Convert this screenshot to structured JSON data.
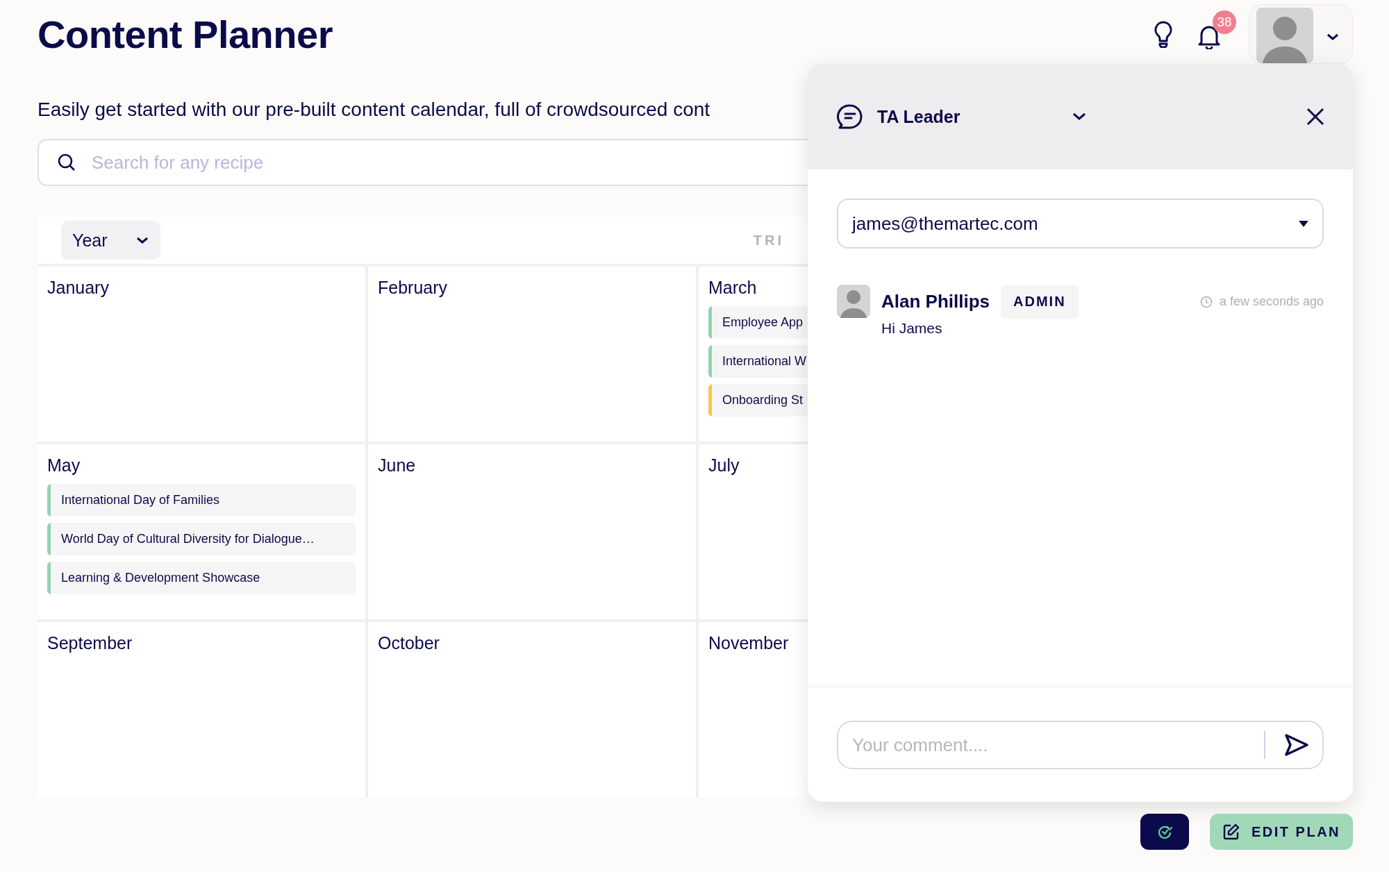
{
  "header": {
    "title": "Content Planner",
    "notification_count": "38"
  },
  "description": "Easily get started with our pre-built content calendar, full of crowdsourced cont",
  "search": {
    "placeholder": "Search for any recipe"
  },
  "toolbar": {
    "view": "Year",
    "column_2": "TRI"
  },
  "months": [
    {
      "name": "January"
    },
    {
      "name": "February"
    },
    {
      "name": "March",
      "events": [
        {
          "title": "Employee App",
          "color": "#8fd4b0"
        },
        {
          "title": "International W",
          "color": "#8fd4b0"
        },
        {
          "title": "Onboarding St",
          "color": "#f5c84c"
        }
      ]
    },
    {
      "name": "May",
      "events": [
        {
          "title": "International Day of Families",
          "color": "#8fd4b0"
        },
        {
          "title": "World Day of Cultural Diversity for Dialogue…",
          "color": "#8fd4b0"
        },
        {
          "title": "Learning & Development Showcase",
          "color": "#8fd4b0"
        }
      ]
    },
    {
      "name": "June"
    },
    {
      "name": "July"
    },
    {
      "name": "September"
    },
    {
      "name": "October"
    },
    {
      "name": "November"
    }
  ],
  "comments_panel": {
    "channel": "TA Leader",
    "recipient": "james@themartec.com",
    "comments": [
      {
        "author": "Alan Phillips",
        "role": "ADMIN",
        "time": "a few seconds ago",
        "text": "Hi James"
      }
    ],
    "comment_input": {
      "placeholder": "Your comment...."
    }
  },
  "actions": {
    "edit_button": "EDIT PLAN"
  }
}
